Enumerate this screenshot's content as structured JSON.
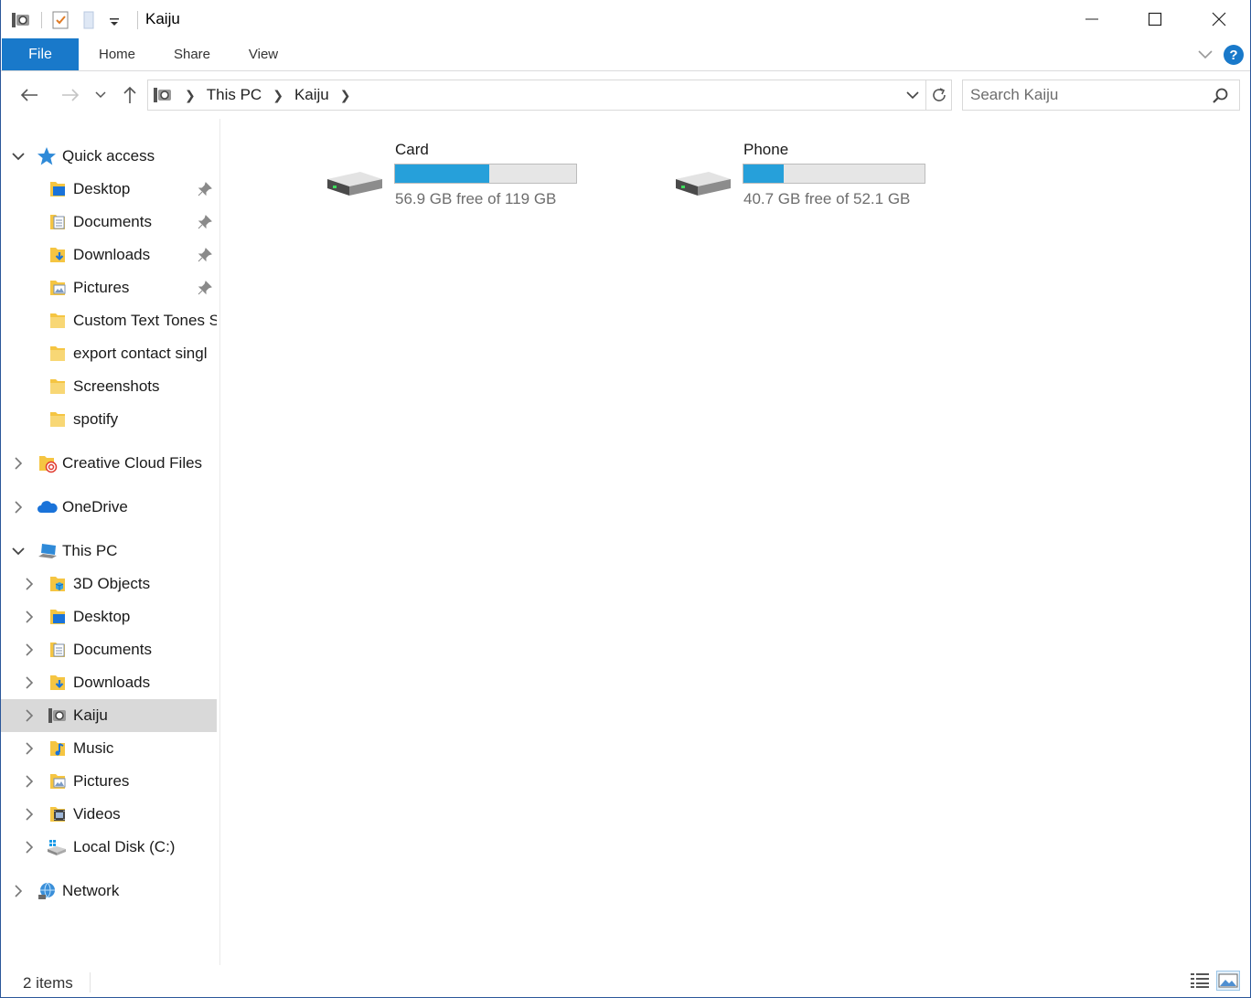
{
  "window": {
    "title": "Kaiju"
  },
  "ribbon": {
    "tabs": [
      {
        "label": "File"
      },
      {
        "label": "Home"
      },
      {
        "label": "Share"
      },
      {
        "label": "View"
      }
    ]
  },
  "address": {
    "crumbs": [
      "This PC",
      "Kaiju"
    ]
  },
  "search": {
    "placeholder": "Search Kaiju"
  },
  "nav": {
    "quick_access": {
      "label": "Quick access",
      "items": [
        {
          "label": "Desktop",
          "pinned": true
        },
        {
          "label": "Documents",
          "pinned": true
        },
        {
          "label": "Downloads",
          "pinned": true
        },
        {
          "label": "Pictures",
          "pinned": true
        },
        {
          "label": "Custom Text Tones S",
          "pinned": false
        },
        {
          "label": "export contact singl",
          "pinned": false
        },
        {
          "label": "Screenshots",
          "pinned": false
        },
        {
          "label": "spotify",
          "pinned": false
        }
      ]
    },
    "creative_cloud": {
      "label": "Creative Cloud Files"
    },
    "onedrive": {
      "label": "OneDrive"
    },
    "this_pc": {
      "label": "This PC",
      "items": [
        {
          "label": "3D Objects"
        },
        {
          "label": "Desktop"
        },
        {
          "label": "Documents"
        },
        {
          "label": "Downloads"
        },
        {
          "label": "Kaiju",
          "selected": true
        },
        {
          "label": "Music"
        },
        {
          "label": "Pictures"
        },
        {
          "label": "Videos"
        },
        {
          "label": "Local Disk (C:)"
        }
      ]
    },
    "network": {
      "label": "Network"
    }
  },
  "drives": [
    {
      "name": "Card",
      "free_text": "56.9 GB free of 119 GB",
      "used_fraction": 0.52
    },
    {
      "name": "Phone",
      "free_text": "40.7 GB free of 52.1 GB",
      "used_fraction": 0.22
    }
  ],
  "status": {
    "count": "2 items"
  },
  "colors": {
    "accent": "#1979ca",
    "bar_fill": "#26a0da",
    "selection": "#d9d9d9"
  }
}
